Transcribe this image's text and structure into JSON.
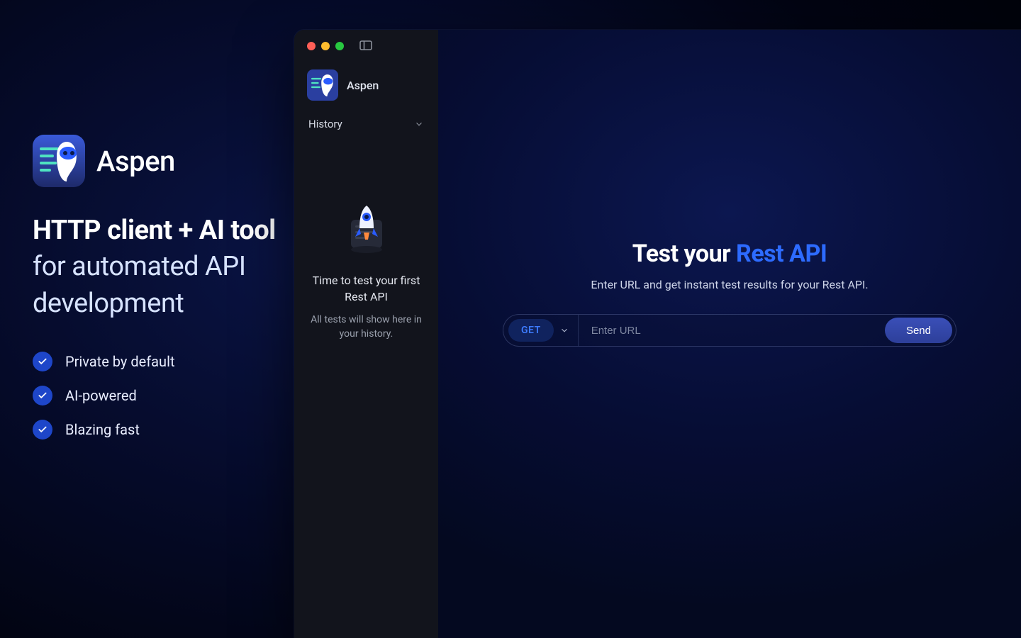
{
  "hero": {
    "name": "Aspen",
    "tagline_bold": "HTTP client + AI tool",
    "tagline_rest": " for automated API development",
    "features": [
      "Private by default",
      "AI-powered",
      "Blazing fast"
    ]
  },
  "sidebar": {
    "app_name": "Aspen",
    "section_label": "History",
    "empty_title": "Time to test your first Rest API",
    "empty_sub": "All tests will show here in your history."
  },
  "main": {
    "title_prefix": "Test your ",
    "title_accent": "Rest API",
    "sub": "Enter URL and get instant test results for your Rest API.",
    "method": "GET",
    "url_placeholder": "Enter URL",
    "send_label": "Send"
  }
}
